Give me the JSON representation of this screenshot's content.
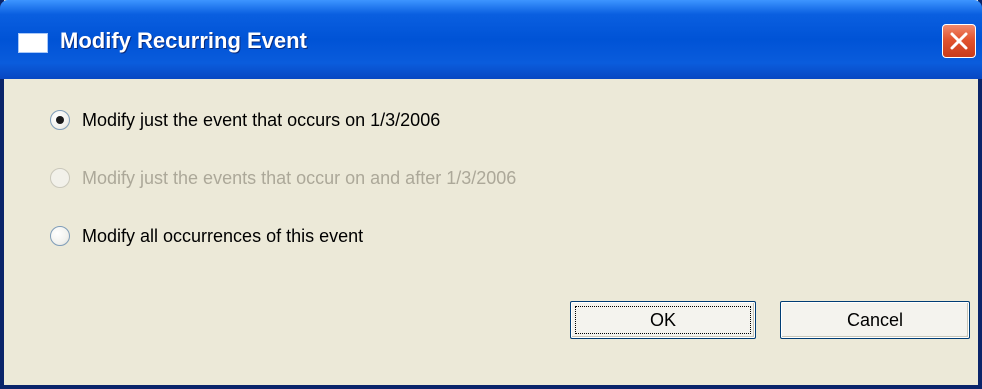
{
  "window": {
    "title": "Modify Recurring Event"
  },
  "options": [
    {
      "label": "Modify just the event that occurs on 1/3/2006",
      "selected": true,
      "enabled": true
    },
    {
      "label": "Modify just the events that occur on and after 1/3/2006",
      "selected": false,
      "enabled": false
    },
    {
      "label": "Modify all occurrences of this event",
      "selected": false,
      "enabled": true
    }
  ],
  "buttons": {
    "ok_label": "OK",
    "cancel_label": "Cancel"
  },
  "colors": {
    "titlebar": "#0053d6",
    "dialog_background": "#ece9d8",
    "close_button": "#e2542f",
    "disabled_text": "#aca899"
  },
  "icons": {
    "title": "window-icon",
    "close": "close-icon"
  }
}
